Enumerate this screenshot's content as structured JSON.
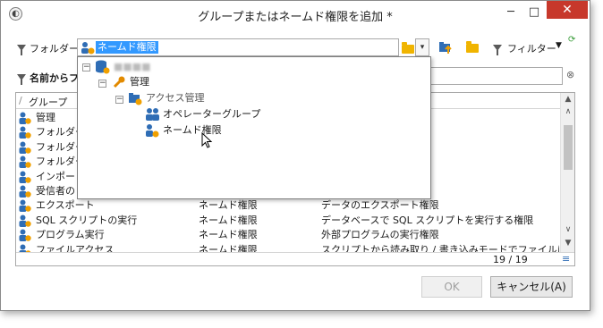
{
  "window": {
    "title": "グループまたはネームド権限を追加 *",
    "minimize_glyph": "─",
    "maximize_glyph": "□",
    "close_glyph": "✕"
  },
  "folder_bar": {
    "label": "フォルダー:",
    "selected_value": "ネームド権限",
    "filter_label": "フィルター",
    "refresh_glyph": "⟳"
  },
  "search_bar": {
    "label": "名前からフ",
    "clear_glyph": "⊗"
  },
  "tree": {
    "root_label": "■■■■",
    "nodes": [
      {
        "label": "管理"
      },
      {
        "label": "アクセス管理"
      },
      {
        "label": "オペレーターグループ"
      },
      {
        "label": "ネームド権限"
      }
    ],
    "expander_glyph": "−"
  },
  "grid": {
    "column_group": "グループ",
    "sort_glyph": "/",
    "rows": [
      {
        "name": "管理",
        "type": "",
        "desc": ""
      },
      {
        "name": "フォルダー",
        "type": "",
        "desc": ""
      },
      {
        "name": "フォルダー",
        "type": "",
        "desc": ""
      },
      {
        "name": "フォルダー",
        "type": "",
        "desc": ""
      },
      {
        "name": "インポート",
        "type": "",
        "desc": ""
      },
      {
        "name": "受信者の",
        "type": "",
        "desc": ""
      },
      {
        "name": "エクスポート",
        "type": "ネームド権限",
        "desc": "データのエクスポート権限"
      },
      {
        "name": "SQL スクリプトの実行",
        "type": "ネームド権限",
        "desc": "データベースで SQL スクリプトを実行する権限"
      },
      {
        "name": "プログラム実行",
        "type": "ネームド権限",
        "desc": "外部プログラムの実行権限"
      },
      {
        "name": "ファイルアクセス",
        "type": "ネームド権限",
        "desc": "スクリプトから読み取り / 書き込みモードでファイルにアクセ..."
      }
    ],
    "count_text": "19 / 19"
  },
  "buttons": {
    "ok": "OK",
    "cancel": "キャンセル(A)"
  },
  "colors": {
    "selection": "#3399ff",
    "close_button": "#c7382b",
    "folder": "#f0b400",
    "user_icon": "#2f6db5"
  }
}
